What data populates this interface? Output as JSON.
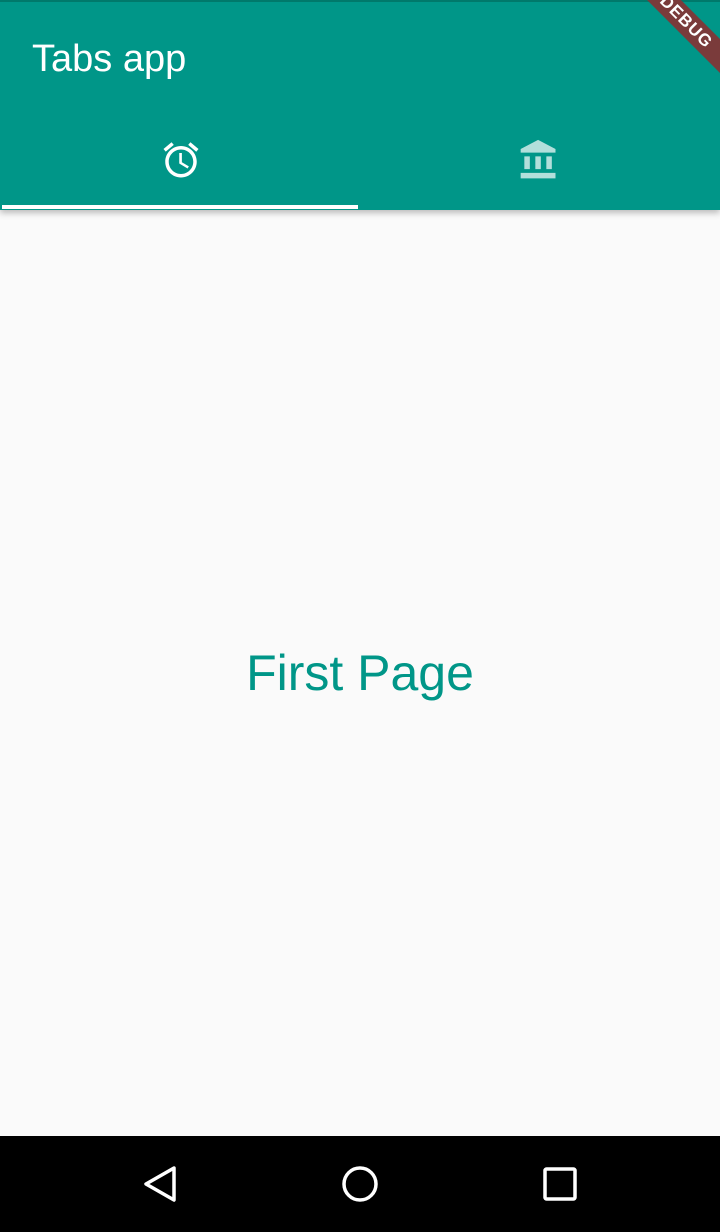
{
  "app": {
    "title": "Tabs app",
    "debug_banner": "DEBUG"
  },
  "tabs": [
    {
      "icon": "alarm-icon",
      "selected": true
    },
    {
      "icon": "account-balance-icon",
      "selected": false
    }
  ],
  "page": {
    "text": "First Page"
  },
  "nav": {
    "back_icon": "back-triangle-icon",
    "home_icon": "home-circle-icon",
    "recent_icon": "recents-square-icon"
  },
  "colors": {
    "primary": "#009688",
    "background": "#fafafa",
    "indicator": "#ffffff",
    "debug_banner": "#7a3b3b",
    "nav_bar": "#000000"
  }
}
